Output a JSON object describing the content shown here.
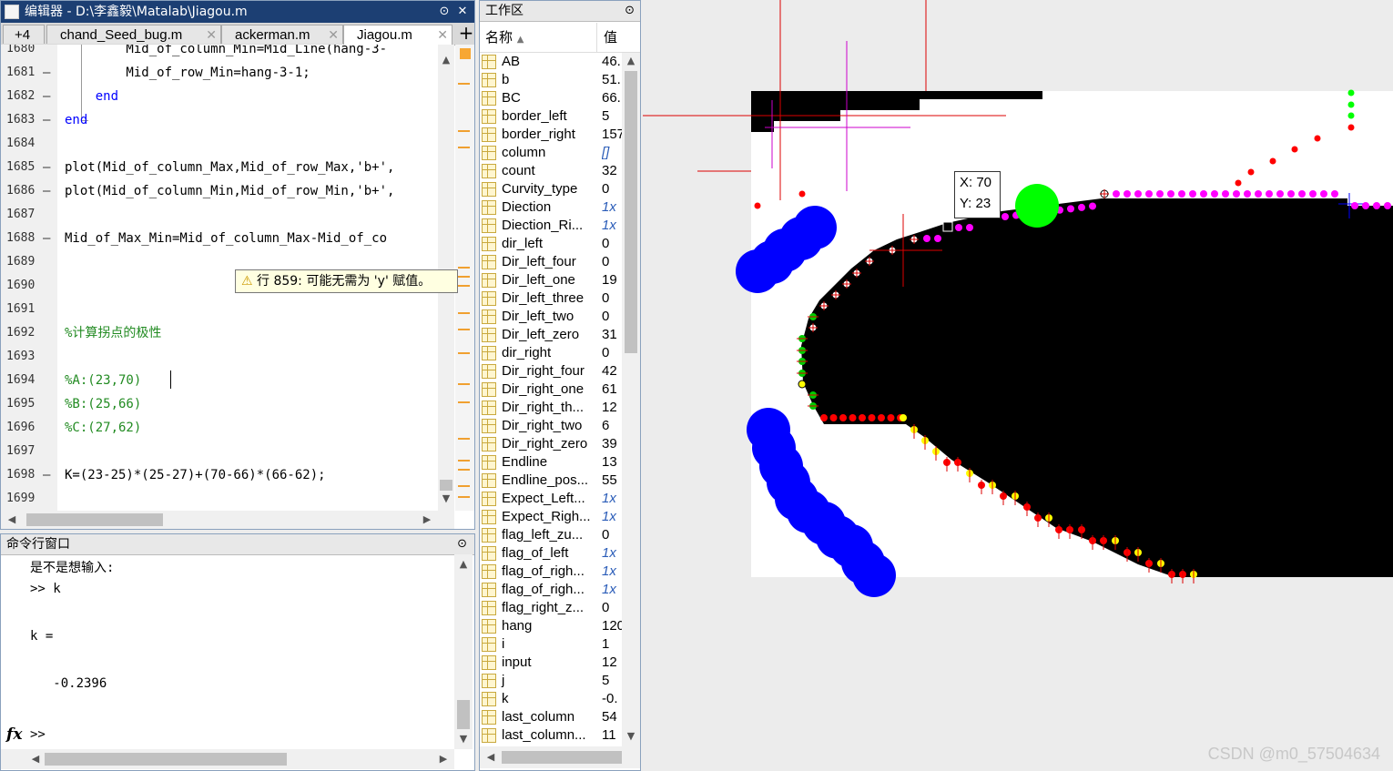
{
  "editor": {
    "title": "编辑器 - D:\\李鑫毅\\Matalab\\Jiagou.m",
    "tabs": [
      {
        "label": "+4"
      },
      {
        "label": "chand_Seed_bug.m"
      },
      {
        "label": "ackerman.m"
      },
      {
        "label": "Jiagou.m"
      }
    ],
    "lines": [
      {
        "num": "1680",
        "dash": "",
        "code": "        Mid_of_column_Min=Mid_Line(hang-3-"
      },
      {
        "num": "1681",
        "dash": "—",
        "code": "        Mid_of_row_Min=hang-3-1;"
      },
      {
        "num": "1682",
        "dash": "—",
        "code": "    end"
      },
      {
        "num": "1683",
        "dash": "—",
        "code": "end"
      },
      {
        "num": "1684",
        "dash": "",
        "code": ""
      },
      {
        "num": "1685",
        "dash": "—",
        "code": "plot(Mid_of_column_Max,Mid_of_row_Max,'b+',"
      },
      {
        "num": "1686",
        "dash": "—",
        "code": "plot(Mid_of_column_Min,Mid_of_row_Min,'b+',"
      },
      {
        "num": "1687",
        "dash": "",
        "code": ""
      },
      {
        "num": "1688",
        "dash": "—",
        "code": "Mid_of_Max_Min=Mid_of_column_Max-Mid_of_co"
      },
      {
        "num": "1689",
        "dash": "",
        "code": ""
      },
      {
        "num": "1690",
        "dash": "",
        "code": ""
      },
      {
        "num": "1691",
        "dash": "",
        "code": ""
      },
      {
        "num": "1692",
        "dash": "",
        "code": "%计算拐点的极性"
      },
      {
        "num": "1693",
        "dash": "",
        "code": ""
      },
      {
        "num": "1694",
        "dash": "",
        "code": "%A:(23,70)"
      },
      {
        "num": "1695",
        "dash": "",
        "code": "%B:(25,66)"
      },
      {
        "num": "1696",
        "dash": "",
        "code": "%C:(27,62)"
      },
      {
        "num": "1697",
        "dash": "",
        "code": ""
      },
      {
        "num": "1698",
        "dash": "—",
        "code": "K=(23-25)*(25-27)+(70-66)*(66-62);"
      },
      {
        "num": "1699",
        "dash": "",
        "code": ""
      }
    ],
    "warning": "行 859: 可能无需为 'y' 赋值。"
  },
  "command": {
    "header": "命令行窗口",
    "lines": [
      "是不是想输入:",
      ">> k",
      "",
      "k =",
      "",
      "   -0.2396",
      ""
    ],
    "prompt": ">>",
    "fx": "fx"
  },
  "workspace": {
    "header": "工作区",
    "col_name": "名称",
    "col_value": "值",
    "vars": [
      {
        "name": "AB",
        "value": "46."
      },
      {
        "name": "b",
        "value": "51."
      },
      {
        "name": "BC",
        "value": "66."
      },
      {
        "name": "border_left",
        "value": "5"
      },
      {
        "name": "border_right",
        "value": "157"
      },
      {
        "name": "column",
        "value": "[]"
      },
      {
        "name": "count",
        "value": "32"
      },
      {
        "name": "Curvity_type",
        "value": "0"
      },
      {
        "name": "Diection",
        "value": "1x"
      },
      {
        "name": "Diection_Ri...",
        "value": "1x"
      },
      {
        "name": "dir_left",
        "value": "0"
      },
      {
        "name": "Dir_left_four",
        "value": "0"
      },
      {
        "name": "Dir_left_one",
        "value": "19"
      },
      {
        "name": "Dir_left_three",
        "value": "0"
      },
      {
        "name": "Dir_left_two",
        "value": "0"
      },
      {
        "name": "Dir_left_zero",
        "value": "31"
      },
      {
        "name": "dir_right",
        "value": "0"
      },
      {
        "name": "Dir_right_four",
        "value": "42"
      },
      {
        "name": "Dir_right_one",
        "value": "61"
      },
      {
        "name": "Dir_right_th...",
        "value": "12"
      },
      {
        "name": "Dir_right_two",
        "value": "6"
      },
      {
        "name": "Dir_right_zero",
        "value": "39"
      },
      {
        "name": "Endline",
        "value": "13"
      },
      {
        "name": "Endline_pos...",
        "value": "55"
      },
      {
        "name": "Expect_Left...",
        "value": "1x"
      },
      {
        "name": "Expect_Righ...",
        "value": "1x"
      },
      {
        "name": "flag_left_zu...",
        "value": "0"
      },
      {
        "name": "flag_of_left",
        "value": "1x"
      },
      {
        "name": "flag_of_righ...",
        "value": "1x"
      },
      {
        "name": "flag_of_righ...",
        "value": "1x"
      },
      {
        "name": "flag_right_z...",
        "value": "0"
      },
      {
        "name": "hang",
        "value": "120"
      },
      {
        "name": "i",
        "value": "1"
      },
      {
        "name": "input",
        "value": "12"
      },
      {
        "name": "j",
        "value": "5"
      },
      {
        "name": "k",
        "value": "-0."
      },
      {
        "name": "last_column",
        "value": "54"
      },
      {
        "name": "last_column...",
        "value": "11"
      }
    ]
  },
  "figure": {
    "tooltip_x": "X: 70",
    "tooltip_y": "Y: 23",
    "watermark": "CSDN @m0_57504634"
  }
}
